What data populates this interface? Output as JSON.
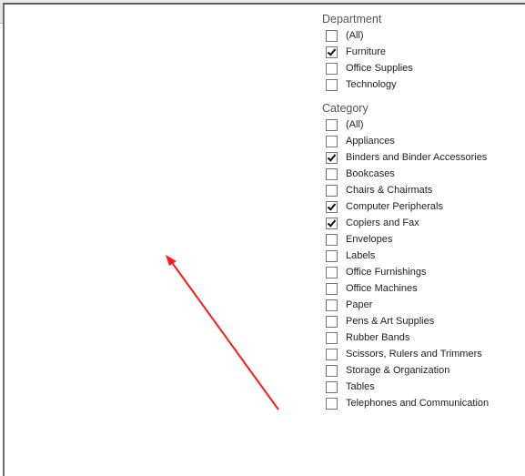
{
  "filters": {
    "department": {
      "title": "Department",
      "items": [
        {
          "label": "(All)",
          "checked": false
        },
        {
          "label": "Furniture",
          "checked": true
        },
        {
          "label": "Office Supplies",
          "checked": false
        },
        {
          "label": "Technology",
          "checked": false
        }
      ]
    },
    "category": {
      "title": "Category",
      "items": [
        {
          "label": "(All)",
          "checked": false
        },
        {
          "label": "Appliances",
          "checked": false
        },
        {
          "label": "Binders and Binder Accessories",
          "checked": true
        },
        {
          "label": "Bookcases",
          "checked": false
        },
        {
          "label": "Chairs & Chairmats",
          "checked": false
        },
        {
          "label": "Computer Peripherals",
          "checked": true
        },
        {
          "label": "Copiers and Fax",
          "checked": true
        },
        {
          "label": "Envelopes",
          "checked": false
        },
        {
          "label": "Labels",
          "checked": false
        },
        {
          "label": "Office Furnishings",
          "checked": false
        },
        {
          "label": "Office Machines",
          "checked": false
        },
        {
          "label": "Paper",
          "checked": false
        },
        {
          "label": "Pens & Art Supplies",
          "checked": false
        },
        {
          "label": "Rubber Bands",
          "checked": false
        },
        {
          "label": "Scissors, Rulers and Trimmers",
          "checked": false
        },
        {
          "label": "Storage & Organization",
          "checked": false
        },
        {
          "label": "Tables",
          "checked": false
        },
        {
          "label": "Telephones and Communication",
          "checked": false
        }
      ]
    }
  },
  "annotation": {
    "icon": "arrow-icon",
    "color": "#ff0000"
  }
}
